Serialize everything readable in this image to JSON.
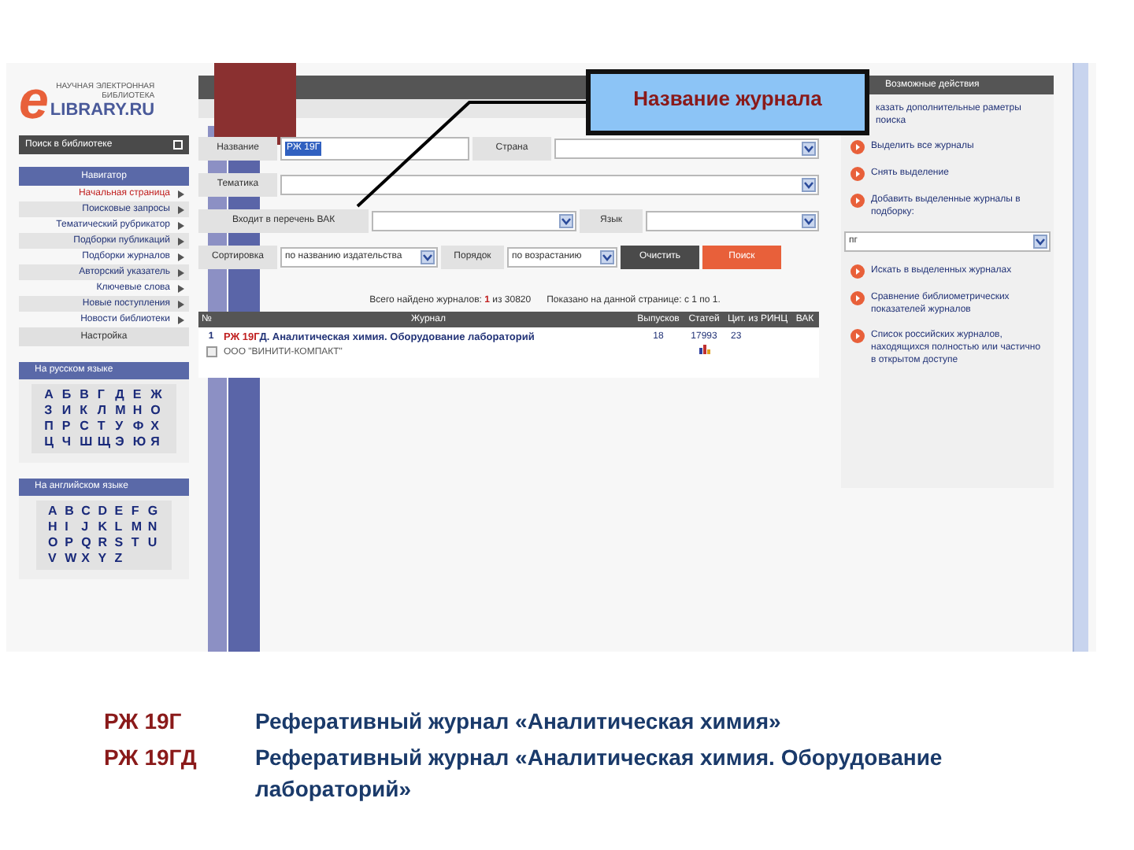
{
  "logo": {
    "top": "НАУЧНАЯ ЭЛЕКТРОННАЯ",
    "middle": "БИБЛИОТЕКА",
    "letter": "e",
    "name": "LIBRARY.RU"
  },
  "sidebar": {
    "search_button": "Поиск в библиотеке",
    "nav_title": "Навигатор",
    "items": [
      {
        "label": "Начальная страница",
        "selected": true
      },
      {
        "label": "Поисковые запросы",
        "selected": false
      },
      {
        "label": "Тематический рубрикатор",
        "selected": false
      },
      {
        "label": "Подборки публикаций",
        "selected": false
      },
      {
        "label": "Подборки журналов",
        "selected": false
      },
      {
        "label": "Авторский указатель",
        "selected": false
      },
      {
        "label": "Ключевые слова",
        "selected": false
      },
      {
        "label": "Новые поступления",
        "selected": false
      },
      {
        "label": "Новости библиотеки",
        "selected": false
      }
    ],
    "settings": "Настройка",
    "alphabets": [
      {
        "title": "На русском языке",
        "letters": [
          "А",
          "Б",
          "В",
          "Г",
          "Д",
          "Е",
          "Ж",
          "З",
          "И",
          "К",
          "Л",
          "М",
          "Н",
          "О",
          "П",
          "Р",
          "С",
          "Т",
          "У",
          "Ф",
          "Х",
          "Ц",
          "Ч",
          "Ш",
          "Щ",
          "Э",
          "Ю",
          "Я"
        ]
      },
      {
        "title": "На английском языке",
        "letters": [
          "A",
          "B",
          "C",
          "D",
          "E",
          "F",
          "G",
          "H",
          "I",
          "J",
          "K",
          "L",
          "M",
          "N",
          "O",
          "P",
          "Q",
          "R",
          "S",
          "T",
          "U",
          "V",
          "W",
          "X",
          "Y",
          "Z"
        ]
      }
    ]
  },
  "form": {
    "name_label": "Название",
    "name_value": "РЖ 19Г",
    "country_label": "Страна",
    "topic_label": "Тематика",
    "vak_label": "Входит в перечень ВАК",
    "language_label": "Язык",
    "sort_label": "Сортировка",
    "sort_value": "по названию издательства",
    "order_label": "Порядок",
    "order_value": "по возрастанию",
    "clear_button": "Очистить",
    "search_button": "Поиск"
  },
  "summary": {
    "found_prefix": "Всего найдено журналов:",
    "found_count": "1",
    "found_suffix": "из 30820",
    "shown": "Показано на данной странице: с 1 по 1."
  },
  "table": {
    "columns": [
      "№",
      "Журнал",
      "Выпусков",
      "Статей",
      "Цит. из РИНЦ",
      "ВАК"
    ],
    "rows": [
      {
        "number": "1",
        "code": "РЖ 19Г",
        "title": "Д. Аналитическая химия. Оборудование лабораторий",
        "publisher": "ООО \"ВИНИТИ-КОМПАКТ\"",
        "issues": "18",
        "articles": "17993",
        "citations": "23",
        "checked": false
      }
    ]
  },
  "callout": "Название журнала",
  "actions": {
    "title": "Возможные действия",
    "items": [
      {
        "kind": "text",
        "label": "казать дополнительные раметры поиска"
      },
      {
        "kind": "link",
        "label": "Выделить все журналы"
      },
      {
        "kind": "link",
        "label": "Снять выделение"
      },
      {
        "kind": "link",
        "label": "Добавить выделенные журналы в подборку:"
      },
      {
        "kind": "select",
        "label": "пг"
      },
      {
        "kind": "link",
        "label": "Искать в выделенных журналах"
      },
      {
        "kind": "link",
        "label": "Сравнение библиометрических показателей журналов"
      },
      {
        "kind": "link",
        "label": "Список российских журналов, находящихся полностью или частично в открытом доступе"
      }
    ]
  },
  "caption": [
    {
      "code": "РЖ 19Г",
      "text": "Реферативный журнал «Аналитическая химия»"
    },
    {
      "code": "РЖ 19ГД",
      "text": "Реферативный журнал «Аналитическая химия. Оборудование лабораторий»"
    }
  ]
}
